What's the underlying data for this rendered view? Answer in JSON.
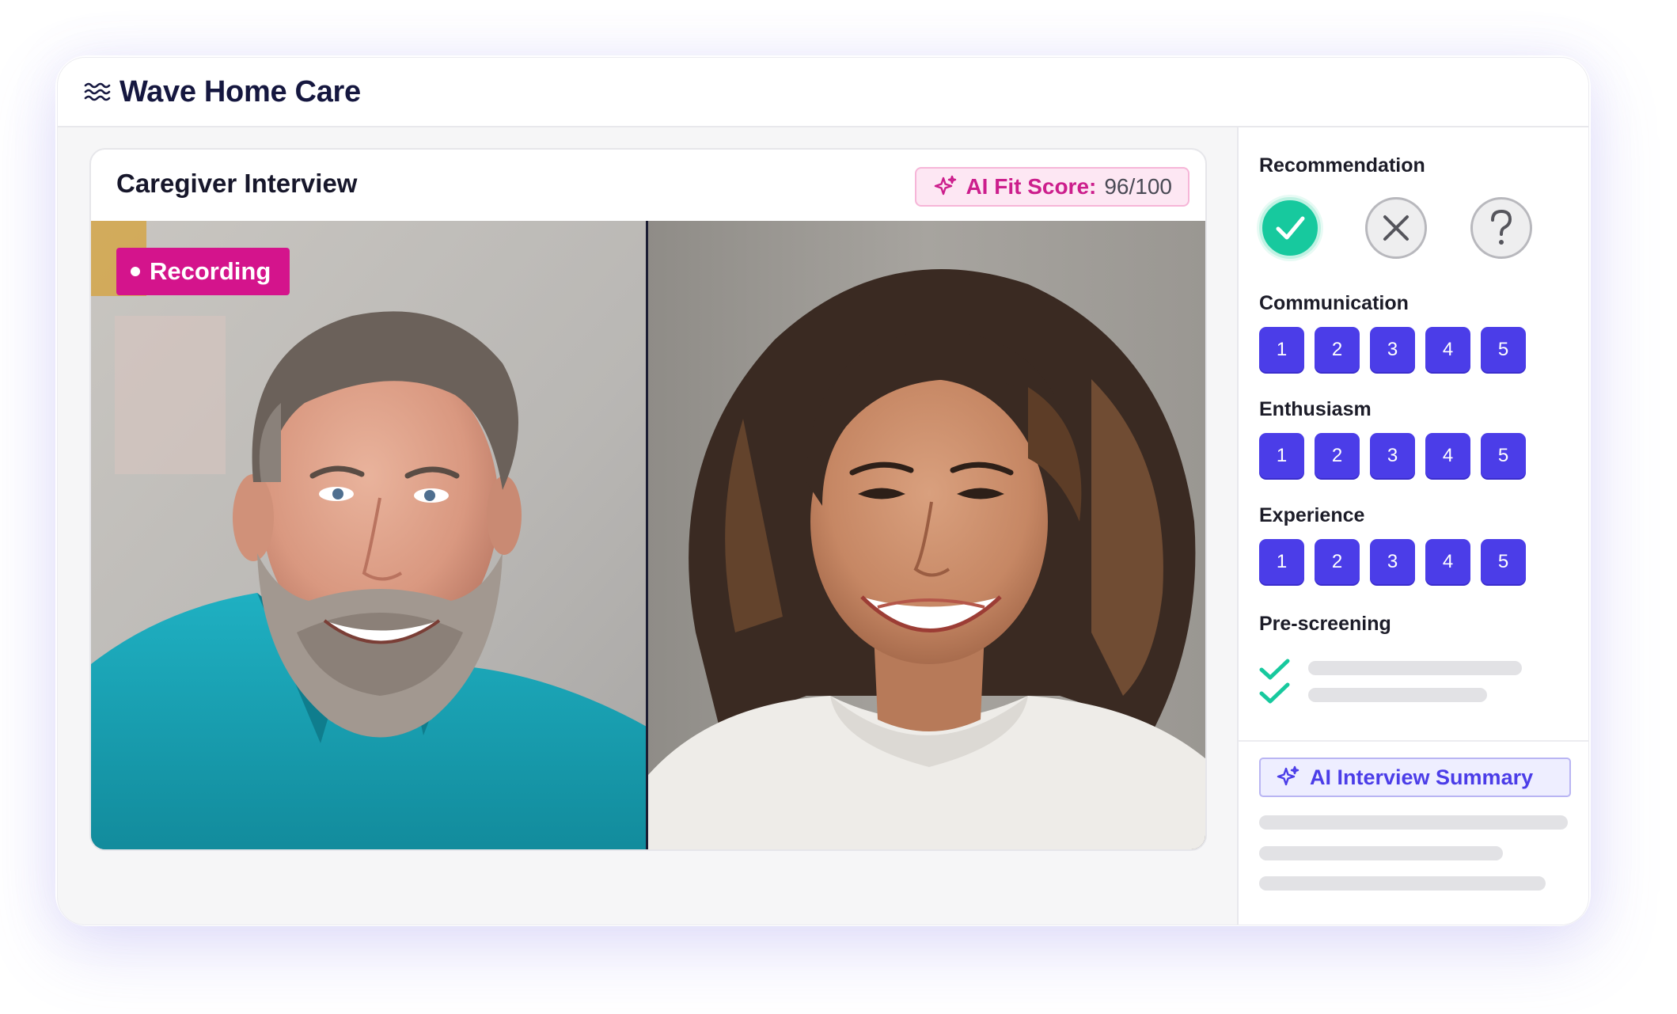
{
  "app": {
    "brand_name": "Wave Home Care",
    "brand_icon": "waves-icon"
  },
  "interview": {
    "title": "Caregiver Interview",
    "fit_score_label": "AI Fit Score:",
    "fit_score_value": "96/100",
    "fit_score_icon": "sparkle-icon",
    "recording_label": "Recording",
    "participants": [
      "man-with-beard-teal-shirt",
      "woman-with-curly-hair-white-sweater"
    ]
  },
  "panel": {
    "recommendation": {
      "label": "Recommendation",
      "options": [
        "check-icon",
        "x-icon",
        "question-icon"
      ],
      "selected": "check-icon"
    },
    "ratings": [
      {
        "label": "Communication",
        "scale": [
          "1",
          "2",
          "3",
          "4",
          "5"
        ]
      },
      {
        "label": "Enthusiasm",
        "scale": [
          "1",
          "2",
          "3",
          "4",
          "5"
        ]
      },
      {
        "label": "Experience",
        "scale": [
          "1",
          "2",
          "3",
          "4",
          "5"
        ]
      }
    ],
    "prescreening": {
      "label": "Pre-screening",
      "items_checked": 2
    },
    "summary": {
      "label": "AI Interview Summary",
      "icon": "sparkle-icon"
    }
  },
  "colors": {
    "brand_text": "#15173f",
    "accent_purple": "#4b3de8",
    "accent_pink": "#d4148c",
    "success_green": "#17c99e"
  }
}
